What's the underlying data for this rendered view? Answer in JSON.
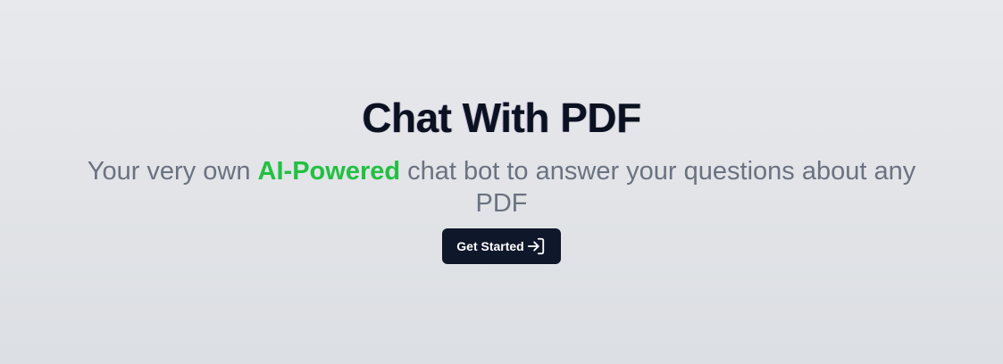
{
  "hero": {
    "title": "Chat With PDF",
    "subtitle_prefix": "Your very own ",
    "subtitle_highlight": "AI-Powered",
    "subtitle_suffix": " chat bot to answer your questions about any PDF",
    "cta_label": "Get Started",
    "cta_icon": "log-in-icon"
  },
  "colors": {
    "highlight": "#22c042",
    "button_bg": "#0f172a",
    "title": "#0b1120",
    "subtitle": "#6b7280"
  }
}
